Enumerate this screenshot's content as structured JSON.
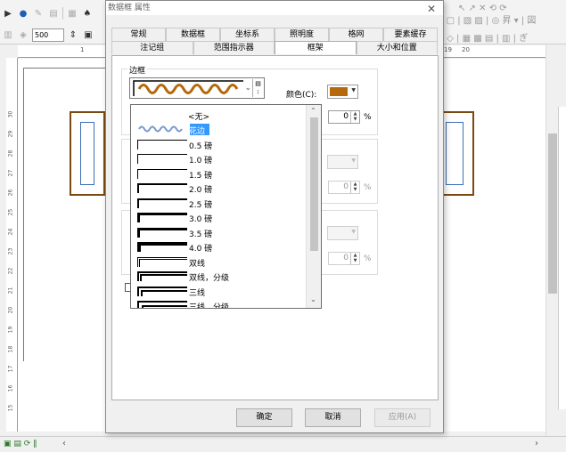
{
  "app": {
    "zoom_value": "500",
    "ruler_h_labels": [
      "1",
      "19",
      "20"
    ],
    "ruler_v_labels": [
      "30",
      "29",
      "28",
      "27",
      "26",
      "25",
      "24",
      "23",
      "22",
      "21",
      "20",
      "19",
      "18",
      "17",
      "16",
      "15",
      "14",
      "13"
    ]
  },
  "dialog": {
    "title": "数据框 属性",
    "tabs_row1": [
      "常规",
      "数据框",
      "坐标系",
      "照明度",
      "格网",
      "要素缓存"
    ],
    "tabs_row2": [
      "注记组",
      "范围指示器",
      "框架",
      "大小和位置"
    ],
    "active_tab": "框架",
    "border_group_title": "边框",
    "color_label": "颜色(C):",
    "color_value": "#b5690a",
    "gap_value": "0",
    "unit": "%",
    "buttons": {
      "ok": "确定",
      "cancel": "取消",
      "apply": "应用(A)"
    }
  },
  "dropdown": {
    "items": [
      {
        "label": "<无>",
        "style": "none"
      },
      {
        "label": "花边",
        "style": "decorative",
        "selected": true
      },
      {
        "label": "0.5 磅",
        "style": "line",
        "weight": 0.5
      },
      {
        "label": "1.0 磅",
        "style": "line",
        "weight": 1.0
      },
      {
        "label": "1.5 磅",
        "style": "line",
        "weight": 1.5
      },
      {
        "label": "2.0 磅",
        "style": "line",
        "weight": 2.0
      },
      {
        "label": "2.5 磅",
        "style": "line",
        "weight": 2.5
      },
      {
        "label": "3.0 磅",
        "style": "line",
        "weight": 3.0
      },
      {
        "label": "3.5 磅",
        "style": "line",
        "weight": 3.5
      },
      {
        "label": "4.0 磅",
        "style": "line",
        "weight": 4.0
      },
      {
        "label": "双线",
        "style": "double"
      },
      {
        "label": "双线，分级",
        "style": "double-graded"
      },
      {
        "label": "三线",
        "style": "triple"
      },
      {
        "label": "三线，分级",
        "style": "triple-graded"
      }
    ]
  },
  "colors": {
    "frame_brown": "#b5690a",
    "selection": "#3399ff"
  }
}
